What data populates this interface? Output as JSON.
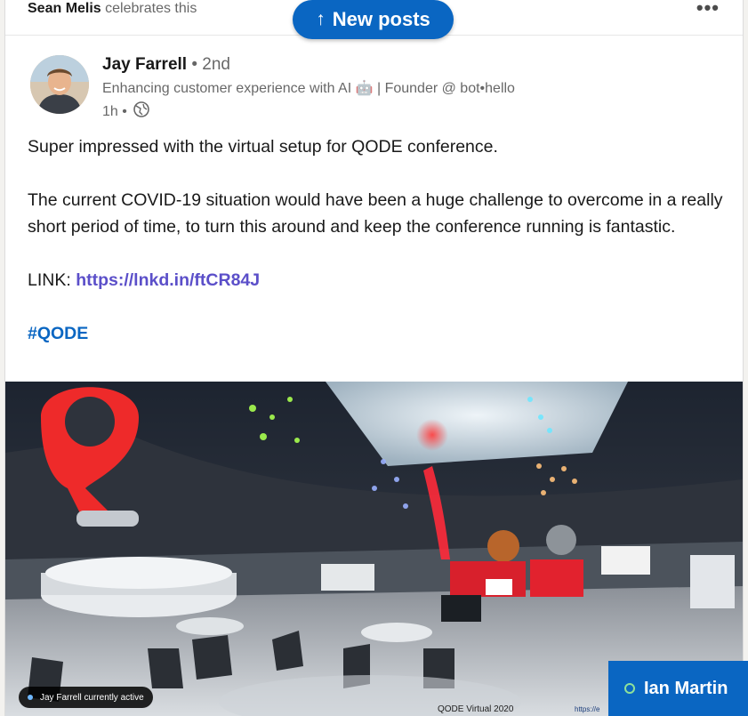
{
  "social": {
    "actor": "Sean Melis",
    "action": "celebrates this",
    "more_label": "•••"
  },
  "new_posts": {
    "arrow": "↑",
    "label": "New posts"
  },
  "author": {
    "name": "Jay Farrell",
    "degree": "• 2nd",
    "headline": "Enhancing customer experience with AI 🤖 | Founder @ bot•hello",
    "time": "1h •"
  },
  "post": {
    "line1": "Super impressed with the virtual setup for QODE conference.",
    "paragraph2": "The current COVID-19 situation would have been a huge challenge to overcome in a really short period of time, to turn this around and keep the conference running is fantastic.",
    "link_prefix": "LINK: ",
    "link": "https://lnkd.in/ftCR84J",
    "hashtag": "#QODE"
  },
  "image": {
    "active_badge": "Jay Farrell currently active",
    "caption": "QODE Virtual 2020",
    "caption2": "https://e"
  },
  "chat": {
    "name": "Ian Martin"
  },
  "colors": {
    "brand": "#0a66c2",
    "link": "#5b4fc9"
  }
}
